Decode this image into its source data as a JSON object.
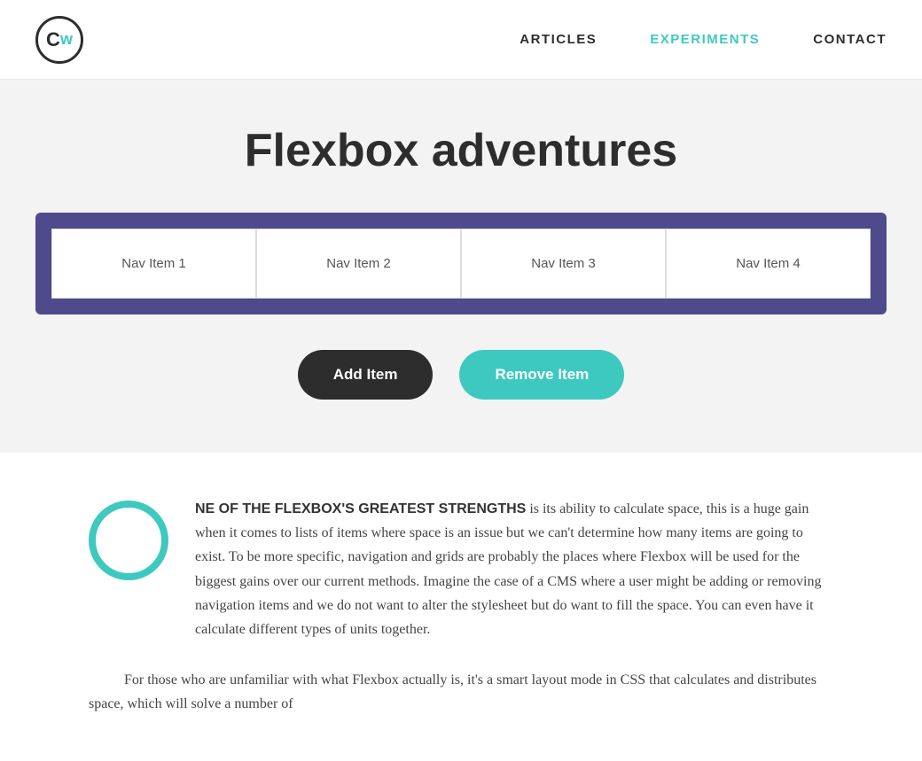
{
  "header": {
    "logo_letter_c": "C",
    "logo_letter_w": "w",
    "nav": {
      "items": [
        {
          "label": "ARTICLES",
          "active": false
        },
        {
          "label": "EXPERIMENTS",
          "active": true
        },
        {
          "label": "CONTACT",
          "active": false
        }
      ]
    }
  },
  "main": {
    "title": "Flexbox adventures",
    "flex_demo": {
      "nav_items": [
        {
          "label": "Nav Item 1"
        },
        {
          "label": "Nav Item 2"
        },
        {
          "label": "Nav Item 3"
        },
        {
          "label": "Nav Item 4"
        }
      ]
    },
    "buttons": {
      "add_label": "Add Item",
      "remove_label": "Remove Item"
    }
  },
  "article": {
    "drop_cap_visible": true,
    "intro_smallcaps": "NE OF THE FLEXBOX'S GREATEST STRENGTHS",
    "intro_text": " is its ability to calculate space, this is a huge gain when it comes to lists of items where space is an issue but we can't determine how many items are going to exist. To be more specific, navigation and grids are probably the places where Flexbox will be used for the biggest gains over our current methods. Imagine the case of a CMS where a user might be adding or removing navigation items and we do not want to alter the stylesheet but do want to fill the space. You can even have it calculate different types of units together.",
    "paragraph2": "For those who are unfamiliar with what Flexbox actually is, it's a smart layout mode in CSS that calculates and distributes space, which will solve a number of"
  }
}
